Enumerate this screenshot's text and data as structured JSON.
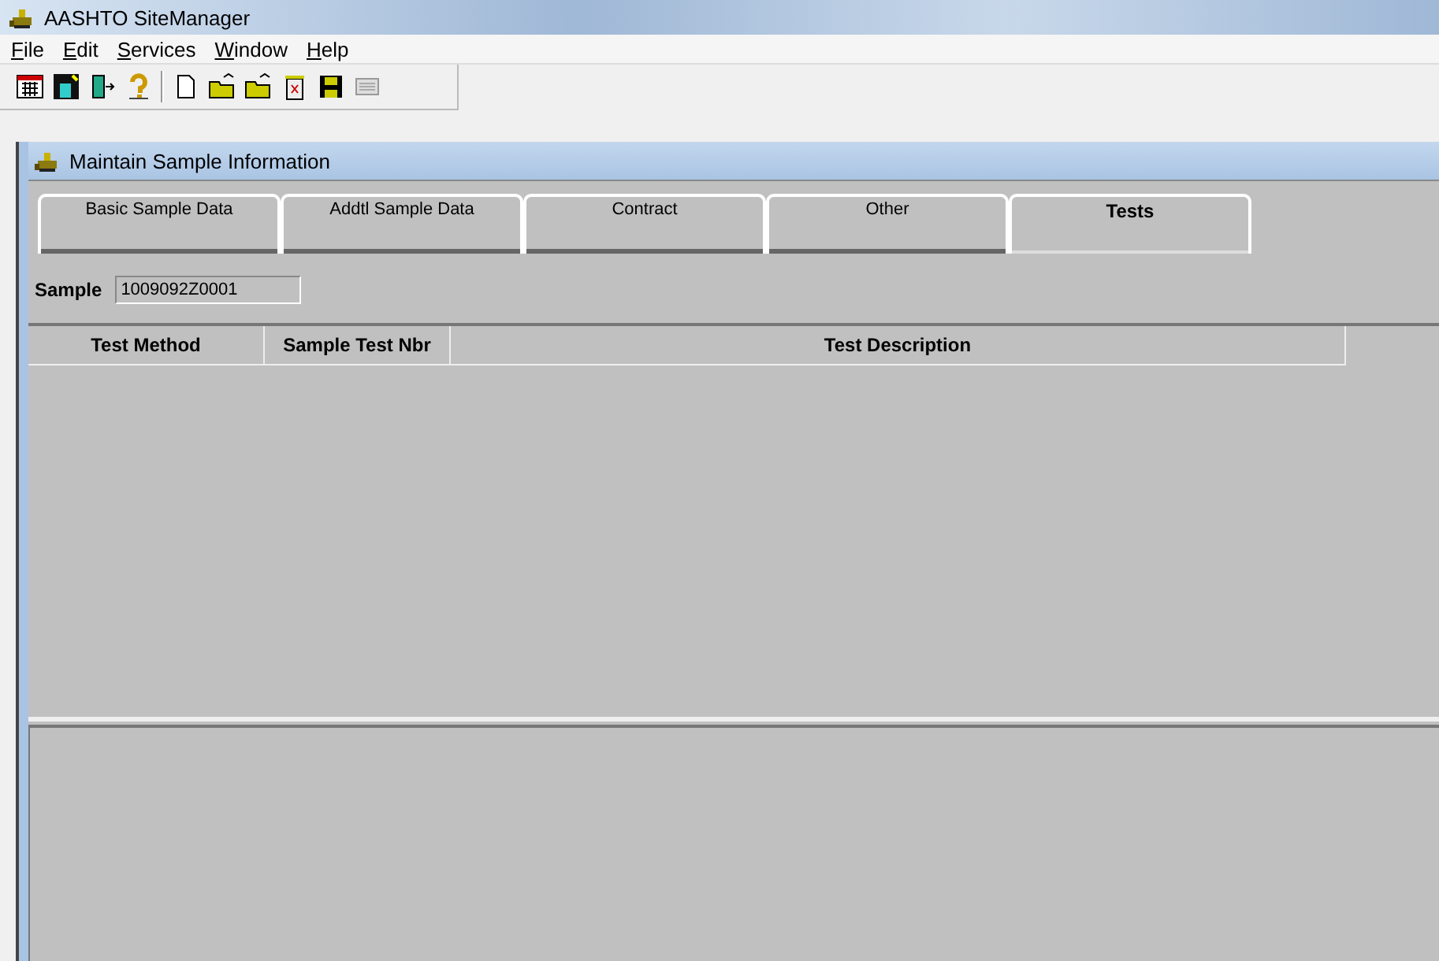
{
  "window": {
    "title": "AASHTO SiteManager"
  },
  "menu": [
    {
      "label": "File"
    },
    {
      "label": "Edit"
    },
    {
      "label": "Services"
    },
    {
      "label": "Window"
    },
    {
      "label": "Help"
    }
  ],
  "toolbar": [
    {
      "kind": "grid"
    },
    {
      "kind": "paint"
    },
    {
      "kind": "exit"
    },
    {
      "kind": "help"
    },
    {
      "kind": "separator"
    },
    {
      "kind": "new"
    },
    {
      "kind": "open"
    },
    {
      "kind": "open"
    },
    {
      "kind": "trash"
    },
    {
      "kind": "save"
    },
    {
      "kind": "disabled"
    }
  ],
  "child_window": {
    "title": "Maintain Sample Information"
  },
  "tabs": [
    {
      "label": "Basic Sample Data",
      "selected": false
    },
    {
      "label": "Addtl Sample Data",
      "selected": false
    },
    {
      "label": "Contract",
      "selected": false
    },
    {
      "label": "Other",
      "selected": false
    },
    {
      "label": "Tests",
      "selected": true
    }
  ],
  "sample": {
    "label": "Sample",
    "value": "1009092Z0001"
  },
  "table": {
    "columns": [
      "Test Method",
      "Sample Test Nbr",
      "Test Description"
    ]
  }
}
